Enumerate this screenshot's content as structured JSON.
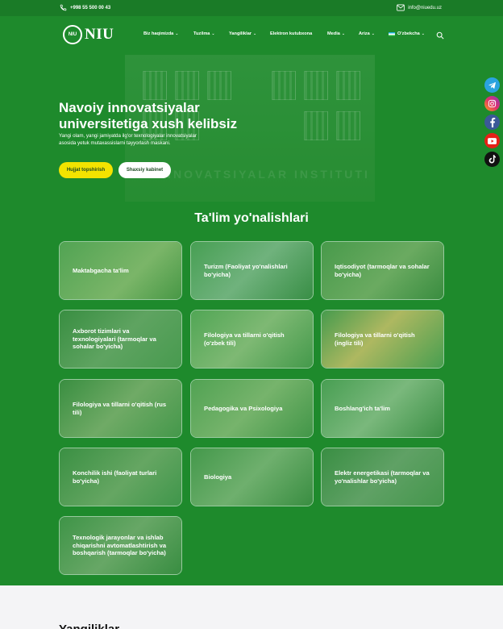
{
  "topbar": {
    "phone": "+998 55 500 00 43",
    "email": "info@niuedu.uz"
  },
  "logo": {
    "seal_text": "NIU",
    "wordmark": "NIU"
  },
  "nav": {
    "items": [
      {
        "label": "Biz haqimizda",
        "has_dropdown": true
      },
      {
        "label": "Tuzilma",
        "has_dropdown": true
      },
      {
        "label": "Yangiliklar",
        "has_dropdown": true
      },
      {
        "label": "Elektron kutubxona",
        "has_dropdown": false
      },
      {
        "label": "Media",
        "has_dropdown": true
      },
      {
        "label": "Ariza",
        "has_dropdown": true
      },
      {
        "label": "O'zbekcha",
        "has_dropdown": true,
        "flag": "uz-flag"
      }
    ]
  },
  "hero": {
    "title": "Navoiy innovatsiyalar universitetiga xush kelibsiz",
    "subtitle": "Yangi olam, yangi jamiyatda ilg'or texnologiyalar innovatsiyalar asosida yetuk mutaxassislarni tayyorlash maskani.",
    "primary_button": "Hujjat topshirish",
    "secondary_button": "Shaxsiy kabinet",
    "background_sign": "INNOVATSIYALAR INSTITUTI"
  },
  "social": [
    "telegram-icon",
    "instagram-icon",
    "facebook-icon",
    "youtube-icon",
    "tiktok-icon"
  ],
  "directions": {
    "title": "Ta'lim yo'nalishlari",
    "cards": [
      "Maktabgacha ta'lim",
      "Turizm (Faoliyat yo'nalishlari bo'yicha)",
      "Iqtisodiyot (tarmoqlar va sohalar bo'yicha)",
      "Axborot tizimlari va texnologiyalari (tarmoqlar va sohalar bo'yicha)",
      "Filologiya va tillarni o'qitish (o'zbek tili)",
      "Filologiya va tillarni o'qitish (ingliz tili)",
      "Filologiya va tillarni o'qitish (rus tili)",
      "Pedagogika va Psixologiya",
      "Boshlang'ich ta'lim",
      "Konchilik ishi (faoliyat turlari bo'yicha)",
      "Biologiya",
      "Elektr energetikasi (tarmoqlar va yo'nalishlar bo'yicha)",
      "Texnologik jarayonlar va ishlab chiqarishni avtomatlashtirish va boshqarish (tarmoqlar bo'yicha)"
    ]
  },
  "news": {
    "title": "Yangiliklar"
  },
  "colors": {
    "primary_green": "#1e8a2c",
    "topbar_green": "#1a7b27",
    "accent_yellow": "#f3e300"
  }
}
